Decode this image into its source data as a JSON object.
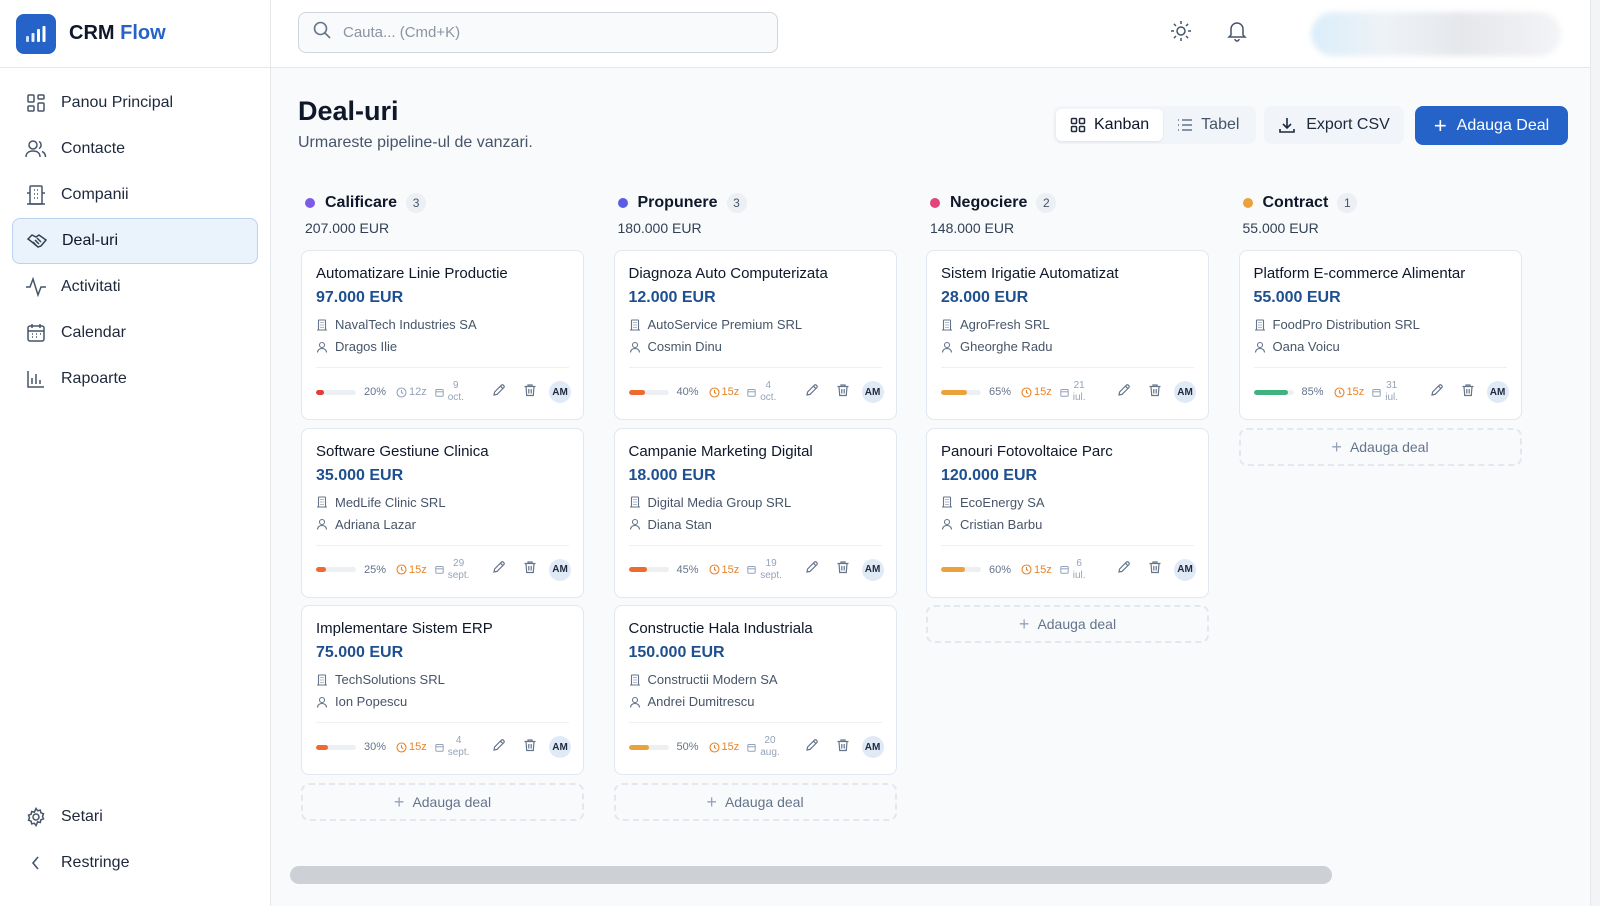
{
  "brand": {
    "name": "CRM",
    "accent": "Flow"
  },
  "sidebar": {
    "items": [
      {
        "label": "Panou Principal",
        "icon": "dashboard-icon"
      },
      {
        "label": "Contacte",
        "icon": "users-icon"
      },
      {
        "label": "Companii",
        "icon": "building-icon"
      },
      {
        "label": "Deal-uri",
        "icon": "handshake-icon",
        "active": true
      },
      {
        "label": "Activitati",
        "icon": "activity-icon"
      },
      {
        "label": "Calendar",
        "icon": "calendar-icon"
      },
      {
        "label": "Rapoarte",
        "icon": "chart-icon"
      }
    ],
    "settings": "Setari",
    "collapse": "Restringe"
  },
  "topbar": {
    "search_placeholder": "Cauta... (Cmd+K)"
  },
  "page": {
    "title": "Deal-uri",
    "subtitle": "Urmareste pipeline-ul de vanzari."
  },
  "toolbar": {
    "kanban": "Kanban",
    "table": "Tabel",
    "export": "Export CSV",
    "add": "Adauga Deal"
  },
  "colors": {
    "primary": "#2563c9",
    "value_text": "#1e4f8f"
  },
  "columns": [
    {
      "name": "Calificare",
      "count": "3",
      "total": "207.000 EUR",
      "color": "#7c5ce6",
      "add_label": "Adauga deal",
      "cards": [
        {
          "title": "Automatizare Linie Productie",
          "value": "97.000 EUR",
          "company": "NavalTech Industries SA",
          "person": "Dragos Ilie",
          "pct": "20%",
          "progress": 0.2,
          "bar": "#e23b3b",
          "age": "12z",
          "age_color": "#94a3b8",
          "day": "9",
          "month": "oct.",
          "avatar": "AM"
        },
        {
          "title": "Software Gestiune Clinica",
          "value": "35.000 EUR",
          "company": "MedLife Clinic SRL",
          "person": "Adriana Lazar",
          "pct": "25%",
          "progress": 0.25,
          "bar": "#ef6a2e",
          "age": "15z",
          "age_color": "#e7842a",
          "day": "29",
          "month": "sept.",
          "avatar": "AM"
        },
        {
          "title": "Implementare Sistem ERP",
          "value": "75.000 EUR",
          "company": "TechSolutions SRL",
          "person": "Ion Popescu",
          "pct": "30%",
          "progress": 0.3,
          "bar": "#ef6a2e",
          "age": "15z",
          "age_color": "#e7842a",
          "day": "4",
          "month": "sept.",
          "avatar": "AM"
        }
      ]
    },
    {
      "name": "Propunere",
      "count": "3",
      "total": "180.000 EUR",
      "color": "#5b5ce6",
      "add_label": "Adauga deal",
      "cards": [
        {
          "title": "Diagnoza Auto Computerizata",
          "value": "12.000 EUR",
          "company": "AutoService Premium SRL",
          "person": "Cosmin Dinu",
          "pct": "40%",
          "progress": 0.4,
          "bar": "#ef6a2e",
          "age": "15z",
          "age_color": "#e7842a",
          "day": "4",
          "month": "oct.",
          "avatar": "AM"
        },
        {
          "title": "Campanie Marketing Digital",
          "value": "18.000 EUR",
          "company": "Digital Media Group SRL",
          "person": "Diana Stan",
          "pct": "45%",
          "progress": 0.45,
          "bar": "#ef6a2e",
          "age": "15z",
          "age_color": "#e7842a",
          "day": "19",
          "month": "sept.",
          "avatar": "AM"
        },
        {
          "title": "Constructie Hala Industriala",
          "value": "150.000 EUR",
          "company": "Constructii Modern SA",
          "person": "Andrei Dumitrescu",
          "pct": "50%",
          "progress": 0.5,
          "bar": "#eaa23a",
          "age": "15z",
          "age_color": "#e7842a",
          "day": "20",
          "month": "aug.",
          "avatar": "AM"
        }
      ]
    },
    {
      "name": "Negociere",
      "count": "2",
      "total": "148.000 EUR",
      "color": "#e0457b",
      "add_label": "Adauga deal",
      "cards": [
        {
          "title": "Sistem Irigatie Automatizat",
          "value": "28.000 EUR",
          "company": "AgroFresh SRL",
          "person": "Gheorghe Radu",
          "pct": "65%",
          "progress": 0.65,
          "bar": "#eaa23a",
          "age": "15z",
          "age_color": "#e7842a",
          "day": "21",
          "month": "iul.",
          "avatar": "AM"
        },
        {
          "title": "Panouri Fotovoltaice Parc",
          "value": "120.000 EUR",
          "company": "EcoEnergy SA",
          "person": "Cristian Barbu",
          "pct": "60%",
          "progress": 0.6,
          "bar": "#eaa23a",
          "age": "15z",
          "age_color": "#e7842a",
          "day": "6",
          "month": "iul.",
          "avatar": "AM"
        }
      ]
    },
    {
      "name": "Contract",
      "count": "1",
      "total": "55.000 EUR",
      "color": "#eaa23a",
      "add_label": "Adauga deal",
      "cards": [
        {
          "title": "Platform E-commerce Alimentar",
          "value": "55.000 EUR",
          "company": "FoodPro Distribution SRL",
          "person": "Oana Voicu",
          "pct": "85%",
          "progress": 0.85,
          "bar": "#3fb27f",
          "age": "15z",
          "age_color": "#e7842a",
          "day": "31",
          "month": "iul.",
          "avatar": "AM"
        }
      ]
    }
  ]
}
